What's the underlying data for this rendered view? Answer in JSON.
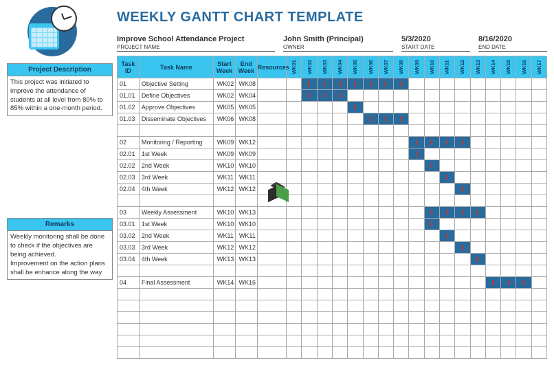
{
  "title": "WEEKLY GANTT CHART TEMPLATE",
  "meta": {
    "project_name": {
      "value": "Improve School Attendance Project",
      "label": "PROJECT NAME"
    },
    "owner": {
      "value": "John Smith (Principal)",
      "label": "OWNER"
    },
    "start_date": {
      "value": "5/3/2020",
      "label": "START DATE"
    },
    "end_date": {
      "value": "8/16/2020",
      "label": "END DATE"
    }
  },
  "sidebar": {
    "desc_hdr": "Project Description",
    "desc_body": "This project was initiated to improve the attendance of students at all level from 80% to 85% within a one-month period.",
    "remarks_hdr": "Remarks",
    "remarks_body": "Weekly monitoring shall be done to check if the objectives are being achieved.\nImprovement on the action plans shall be enhance along the way."
  },
  "columns": {
    "task_id": "Task ID",
    "task_name": "Task Name",
    "start_week": "Start Week",
    "end_week": "End Week",
    "resources": "Resources"
  },
  "weeks": [
    "WK01",
    "WK02",
    "WK03",
    "WK04",
    "WK05",
    "WK06",
    "WK07",
    "WK08",
    "WK09",
    "WK10",
    "WK11",
    "WK12",
    "WK13",
    "WK14",
    "WK15",
    "WK16",
    "WK17"
  ],
  "tasks": [
    {
      "id": "01",
      "name": "Objective Setting",
      "sw": "WK02",
      "ew": "WK08",
      "res": "",
      "bars": [
        2,
        3,
        4,
        5,
        6,
        7,
        8
      ]
    },
    {
      "id": "01.01",
      "name": "Define Objectives",
      "sw": "WK02",
      "ew": "WK04",
      "res": "",
      "bars": [
        2,
        3,
        4
      ]
    },
    {
      "id": "01.02",
      "name": "Approve Objectives",
      "sw": "WK05",
      "ew": "WK05",
      "res": "",
      "bars": [
        5
      ]
    },
    {
      "id": "01.03",
      "name": "Disseminate Objectives",
      "sw": "WK06",
      "ew": "WK08",
      "res": "",
      "bars": [
        6,
        7,
        8
      ]
    },
    {
      "id": "",
      "name": "",
      "sw": "",
      "ew": "",
      "res": "",
      "bars": []
    },
    {
      "id": "02",
      "name": "Monitoring / Reporting",
      "sw": "WK09",
      "ew": "WK12",
      "res": "",
      "bars": [
        9,
        10,
        11,
        12
      ]
    },
    {
      "id": "02.01",
      "name": "1st Week",
      "sw": "WK09",
      "ew": "WK09",
      "res": "",
      "bars": [
        9
      ]
    },
    {
      "id": "02.02",
      "name": "2nd Week",
      "sw": "WK10",
      "ew": "WK10",
      "res": "",
      "bars": [
        10
      ]
    },
    {
      "id": "02.03",
      "name": "3rd Week",
      "sw": "WK11",
      "ew": "WK11",
      "res": "",
      "bars": [
        11
      ]
    },
    {
      "id": "02.04",
      "name": "4th Week",
      "sw": "WK12",
      "ew": "WK12",
      "res": "",
      "bars": [
        12
      ]
    },
    {
      "id": "",
      "name": "",
      "sw": "",
      "ew": "",
      "res": "",
      "bars": []
    },
    {
      "id": "03",
      "name": "Weekly Assessment",
      "sw": "WK10",
      "ew": "WK13",
      "res": "",
      "bars": [
        10,
        11,
        12,
        13
      ]
    },
    {
      "id": "03.01",
      "name": "1st Week",
      "sw": "WK10",
      "ew": "WK10",
      "res": "",
      "bars": [
        10
      ]
    },
    {
      "id": "03.02",
      "name": "2nd Week",
      "sw": "WK11",
      "ew": "WK11",
      "res": "",
      "bars": [
        11
      ]
    },
    {
      "id": "03.03",
      "name": "3rd Week",
      "sw": "WK12",
      "ew": "WK12",
      "res": "",
      "bars": [
        12
      ]
    },
    {
      "id": "03.04",
      "name": "4th Week",
      "sw": "WK13",
      "ew": "WK13",
      "res": "",
      "bars": [
        13
      ]
    },
    {
      "id": "",
      "name": "",
      "sw": "",
      "ew": "",
      "res": "",
      "bars": []
    },
    {
      "id": "04",
      "name": "Final Assessment",
      "sw": "WK14",
      "ew": "WK16",
      "res": "",
      "bars": [
        14,
        15,
        16
      ]
    },
    {
      "id": "",
      "name": "",
      "sw": "",
      "ew": "",
      "res": "",
      "bars": []
    },
    {
      "id": "",
      "name": "",
      "sw": "",
      "ew": "",
      "res": "",
      "bars": []
    },
    {
      "id": "",
      "name": "",
      "sw": "",
      "ew": "",
      "res": "",
      "bars": []
    },
    {
      "id": "",
      "name": "",
      "sw": "",
      "ew": "",
      "res": "",
      "bars": []
    },
    {
      "id": "",
      "name": "",
      "sw": "",
      "ew": "",
      "res": "",
      "bars": []
    },
    {
      "id": "",
      "name": "",
      "sw": "",
      "ew": "",
      "res": "",
      "bars": []
    }
  ],
  "chart_data": {
    "type": "bar",
    "title": "WEEKLY GANTT CHART TEMPLATE",
    "categories": [
      "WK01",
      "WK02",
      "WK03",
      "WK04",
      "WK05",
      "WK06",
      "WK07",
      "WK08",
      "WK09",
      "WK10",
      "WK11",
      "WK12",
      "WK13",
      "WK14",
      "WK15",
      "WK16",
      "WK17"
    ],
    "series": [
      {
        "name": "Objective Setting",
        "start": "WK02",
        "end": "WK08"
      },
      {
        "name": "Define Objectives",
        "start": "WK02",
        "end": "WK04"
      },
      {
        "name": "Approve Objectives",
        "start": "WK05",
        "end": "WK05"
      },
      {
        "name": "Disseminate Objectives",
        "start": "WK06",
        "end": "WK08"
      },
      {
        "name": "Monitoring / Reporting",
        "start": "WK09",
        "end": "WK12"
      },
      {
        "name": "1st Week (Monitoring)",
        "start": "WK09",
        "end": "WK09"
      },
      {
        "name": "2nd Week (Monitoring)",
        "start": "WK10",
        "end": "WK10"
      },
      {
        "name": "3rd Week (Monitoring)",
        "start": "WK11",
        "end": "WK11"
      },
      {
        "name": "4th Week (Monitoring)",
        "start": "WK12",
        "end": "WK12"
      },
      {
        "name": "Weekly Assessment",
        "start": "WK10",
        "end": "WK13"
      },
      {
        "name": "1st Week (Assessment)",
        "start": "WK10",
        "end": "WK10"
      },
      {
        "name": "2nd Week (Assessment)",
        "start": "WK11",
        "end": "WK11"
      },
      {
        "name": "3rd Week (Assessment)",
        "start": "WK12",
        "end": "WK12"
      },
      {
        "name": "4th Week (Assessment)",
        "start": "WK13",
        "end": "WK13"
      },
      {
        "name": "Final Assessment",
        "start": "WK14",
        "end": "WK16"
      }
    ],
    "xlabel": "Week",
    "ylabel": "Task"
  }
}
